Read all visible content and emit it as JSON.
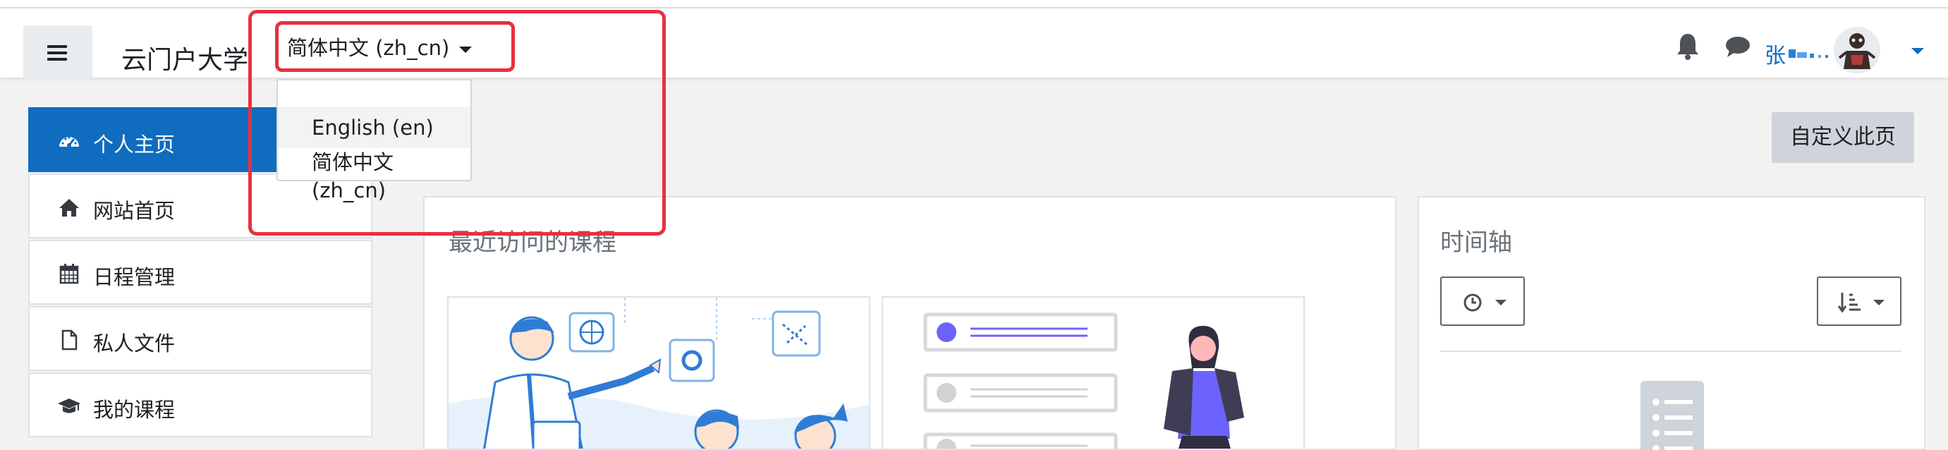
{
  "navbar": {
    "site_name": "云门户大学",
    "language_selected": "简体中文 (zh_cn)",
    "user_name": "张",
    "colors": {
      "link": "#0f6cbf",
      "active": "#0f6cbf",
      "highlight": "#e8303f"
    }
  },
  "language_menu": {
    "options": [
      {
        "label": "English (en)"
      },
      {
        "label": "简体中文 (zh_cn)"
      }
    ]
  },
  "sidebar": {
    "items": [
      {
        "label": "个人主页",
        "icon": "dashboard-icon",
        "active": true
      },
      {
        "label": "网站首页",
        "icon": "home-icon",
        "active": false
      },
      {
        "label": "日程管理",
        "icon": "calendar-icon",
        "active": false
      },
      {
        "label": "私人文件",
        "icon": "file-icon",
        "active": false
      },
      {
        "label": "我的课程",
        "icon": "graduation-cap-icon",
        "active": false
      }
    ]
  },
  "page": {
    "customize_button": "自定义此页"
  },
  "recent_courses": {
    "title": "最近访问的课程"
  },
  "timeline": {
    "title": "时间轴"
  }
}
